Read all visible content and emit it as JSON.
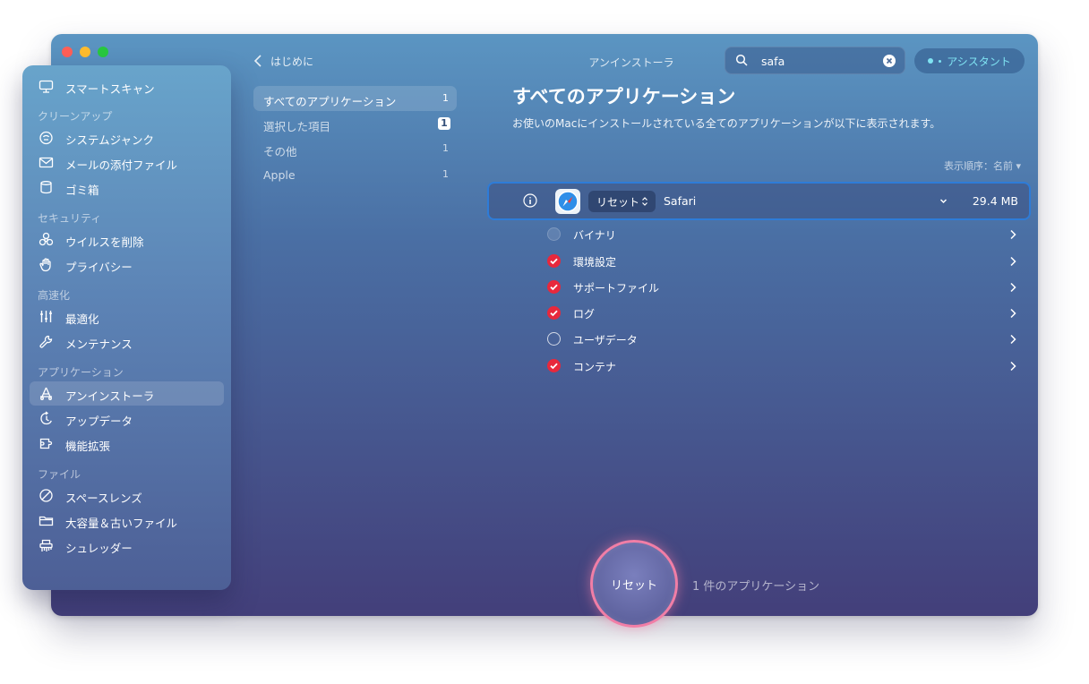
{
  "window": {
    "title": "アンインストーラ",
    "back_label": "はじめに"
  },
  "search": {
    "value": "safa",
    "placeholder": ""
  },
  "assistant": {
    "label": "アシスタント"
  },
  "sidebar": {
    "items": [
      {
        "label": "スマートスキャン",
        "icon": "monitor-icon"
      },
      {
        "section": "クリーンアップ"
      },
      {
        "label": "システムジャンク",
        "icon": "junk-icon"
      },
      {
        "label": "メールの添付ファイル",
        "icon": "mail-icon"
      },
      {
        "label": "ゴミ箱",
        "icon": "trash-icon"
      },
      {
        "section": "セキュリティ"
      },
      {
        "label": "ウイルスを削除",
        "icon": "biohazard-icon"
      },
      {
        "label": "プライバシー",
        "icon": "hand-icon"
      },
      {
        "section": "高速化"
      },
      {
        "label": "最適化",
        "icon": "sliders-icon"
      },
      {
        "label": "メンテナンス",
        "icon": "wrench-icon"
      },
      {
        "section": "アプリケーション"
      },
      {
        "label": "アンインストーラ",
        "icon": "uninstaller-icon",
        "active": true
      },
      {
        "label": "アップデータ",
        "icon": "updater-icon"
      },
      {
        "label": "機能拡張",
        "icon": "extensions-icon"
      },
      {
        "section": "ファイル"
      },
      {
        "label": "スペースレンズ",
        "icon": "space-lens-icon"
      },
      {
        "label": "大容量＆古いファイル",
        "icon": "folder-icon"
      },
      {
        "label": "シュレッダー",
        "icon": "shredder-icon"
      }
    ]
  },
  "categories": [
    {
      "label": "すべてのアプリケーション",
      "count": "1",
      "active": true
    },
    {
      "label": "選択した項目",
      "count": "1",
      "boxed": true
    },
    {
      "label": "その他",
      "count": "1"
    },
    {
      "label": "Apple",
      "count": "1"
    }
  ],
  "main": {
    "title": "すべてのアプリケーション",
    "subtitle": "お使いのMacにインストールされている全てのアプリケーションが以下に表示されます。",
    "sort_label": "表示順序：名前 ▾"
  },
  "app": {
    "name": "Safari",
    "size": "29.4 MB",
    "action": "リセット",
    "icon": "safari-icon"
  },
  "sub_items": [
    {
      "label": "バイナリ",
      "state": "dim"
    },
    {
      "label": "環境設定",
      "state": "on"
    },
    {
      "label": "サポートファイル",
      "state": "on"
    },
    {
      "label": "ログ",
      "state": "on"
    },
    {
      "label": "ユーザデータ",
      "state": "off"
    },
    {
      "label": "コンテナ",
      "state": "on"
    }
  ],
  "footer": {
    "button_label": "リセット",
    "count_text": "1 件のアプリケーション"
  }
}
